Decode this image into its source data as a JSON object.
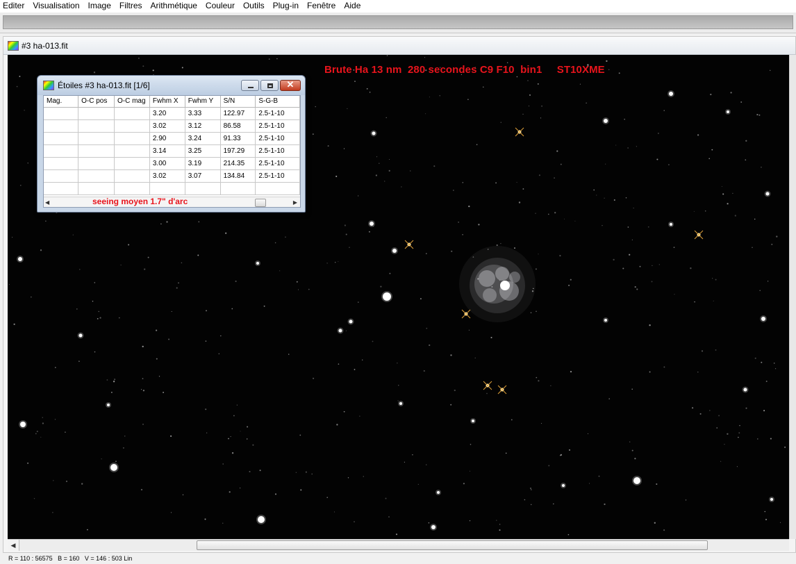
{
  "menu": [
    "Editer",
    "Visualisation",
    "Image",
    "Filtres",
    "Arithmétique",
    "Couleur",
    "Outils",
    "Plug-in",
    "Fenêtre",
    "Aide"
  ],
  "document": {
    "title": "#3 ha-013.fit",
    "overlay_label": "Brute Ha 13 nm  280 secondes C9 F10  bin1     ST10XME"
  },
  "stars_window": {
    "title": "Étoiles #3 ha-013.fit  [1/6]",
    "columns": [
      "Mag.",
      "O-C pos",
      "O-C mag",
      "Fwhm X",
      "Fwhm Y",
      "S/N",
      "S-G-B"
    ],
    "rows": [
      [
        "",
        "",
        "",
        "3.20",
        "3.33",
        "122.97",
        "2.5-1-10"
      ],
      [
        "",
        "",
        "",
        "3.02",
        "3.12",
        "86.58",
        "2.5-1-10"
      ],
      [
        "",
        "",
        "",
        "2.90",
        "3.24",
        "91.33",
        "2.5-1-10"
      ],
      [
        "",
        "",
        "",
        "3.14",
        "3.25",
        "197.29",
        "2.5-1-10"
      ],
      [
        "",
        "",
        "",
        "3.00",
        "3.19",
        "214.35",
        "2.5-1-10"
      ],
      [
        "",
        "",
        "",
        "3.02",
        "3.07",
        "134.84",
        "2.5-1-10"
      ],
      [
        "",
        "",
        "",
        "",
        "",
        "",
        ""
      ]
    ],
    "annotation": "seeing moyen 1.7\" d'arc"
  },
  "status": "R = 110 : 56575   B = 160   V = 146 : 503 Lin",
  "colors": {
    "annotation_red": "#e8141c",
    "sky": "#000000"
  },
  "icons": [
    "app-icon",
    "minimize-icon",
    "maximize-icon",
    "close-icon",
    "scroll-left-icon",
    "scroll-right-icon"
  ]
}
